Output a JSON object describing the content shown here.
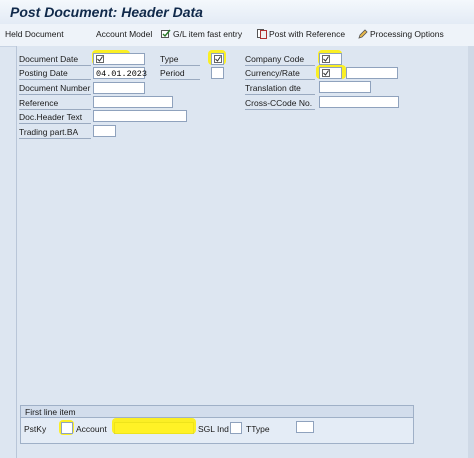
{
  "screen": {
    "title": "Post Document: Header Data"
  },
  "toolbar": {
    "held_document": "Held Document",
    "account_model": "Account Model",
    "gl_item_fast_entry": "G/L item fast entry",
    "post_with_reference": "Post with Reference",
    "processing_options": "Processing Options"
  },
  "header": {
    "document_date_label": "Document Date",
    "posting_date_label": "Posting Date",
    "posting_date_value": "04.01.2023",
    "document_number_label": "Document Number",
    "reference_label": "Reference",
    "doc_header_text_label": "Doc.Header Text",
    "trading_part_label": "Trading part.BA",
    "type_label": "Type",
    "period_label": "Period",
    "company_code_label": "Company Code",
    "currency_rate_label": "Currency/Rate",
    "translation_date_label": "Translation dte",
    "cross_ccode_label": "Cross-CCode No."
  },
  "first_line_item": {
    "title": "First line item",
    "pstky_label": "PstKy",
    "account_label": "Account",
    "sgl_ind_label": "SGL Ind",
    "ttype_label": "TType"
  },
  "colors": {
    "highlight": "#fff000",
    "background": "#dde6f1",
    "field_border": "#8fa2bd"
  },
  "icons": [
    "required-check-icon",
    "gl-fast-entry-icon",
    "post-reference-icon",
    "pencil-icon"
  ]
}
